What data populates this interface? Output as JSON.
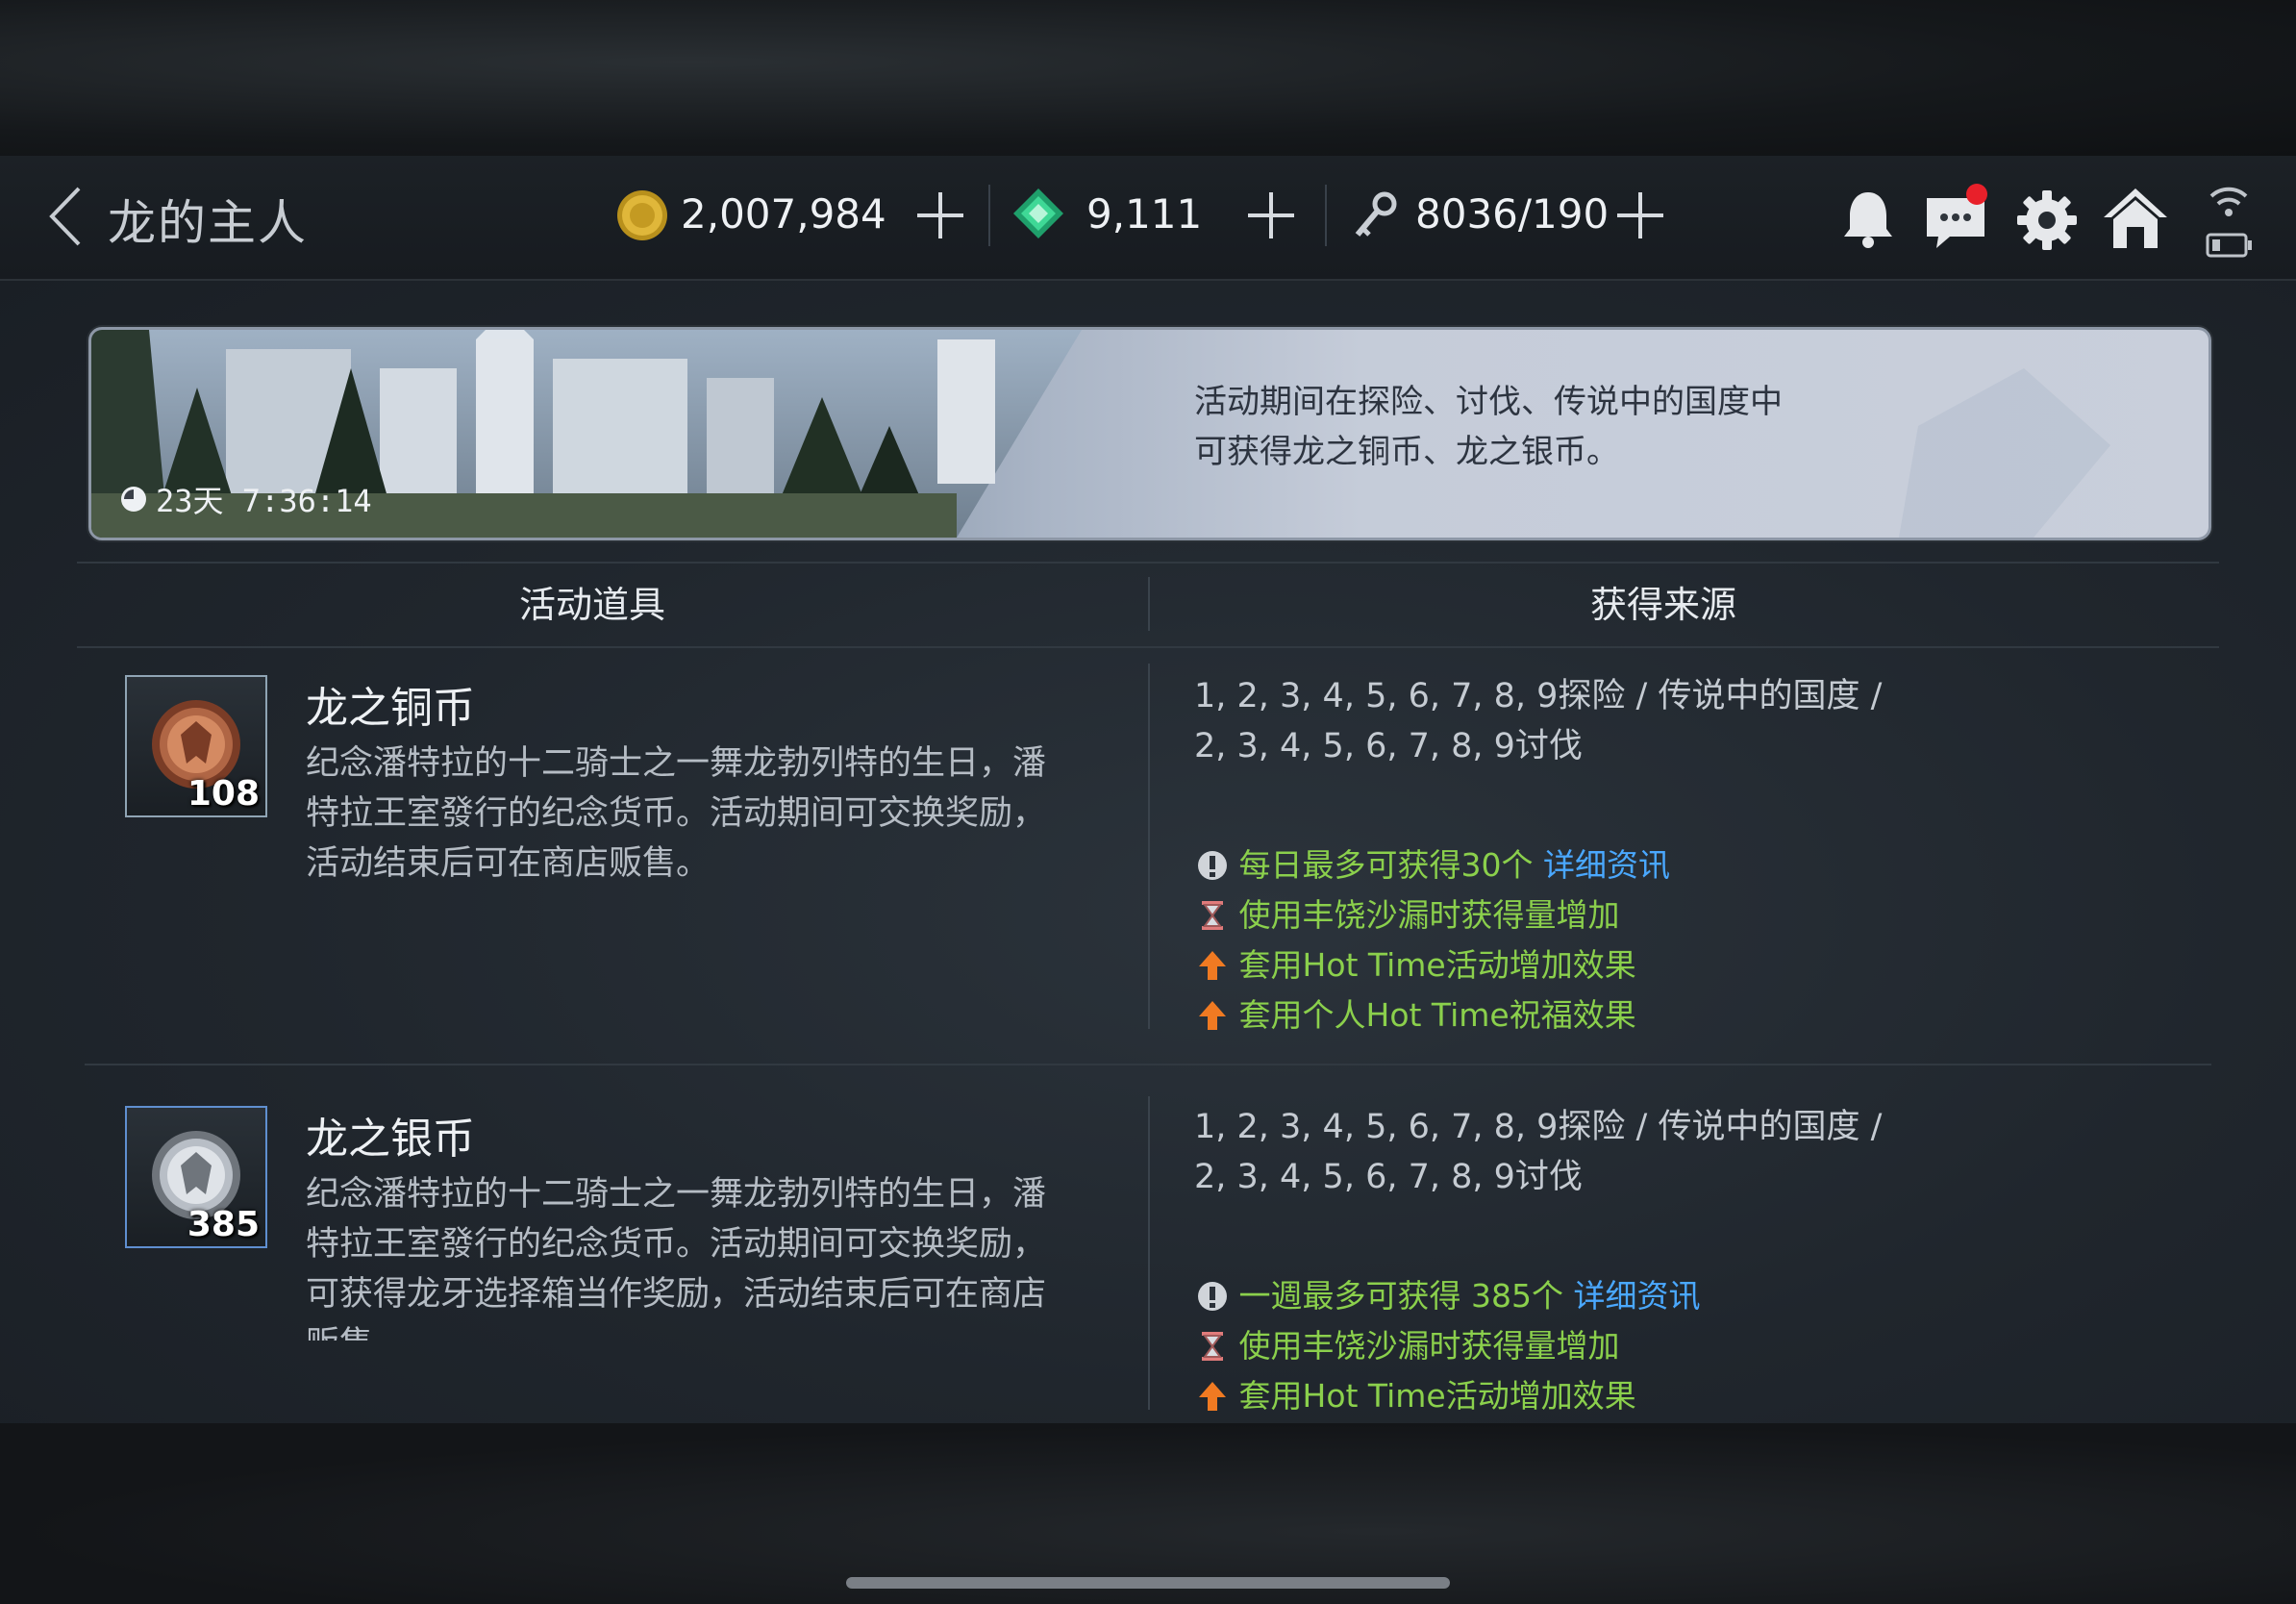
{
  "header": {
    "title": "龙的主人",
    "gold": "2,007,984",
    "gems": "9,111",
    "stamina": "8036/190"
  },
  "banner": {
    "timer": "23天 7:36:14",
    "text_line1": "活动期间在探险、讨伐、传说中的国度中",
    "text_line2": "可获得龙之铜币、龙之银币。"
  },
  "table": {
    "col1": "活动道具",
    "col2": "获得来源"
  },
  "items": [
    {
      "name": "龙之铜币",
      "count": "108",
      "desc_line1": "纪念潘特拉的十二骑士之一舞龙勃列特的生日，潘",
      "desc_line2": "特拉王室發行的纪念货币。活动期间可交换奖励，",
      "desc_line3": "活动结束后可在商店贩售。",
      "desc_line4": "",
      "source_line1": "1, 2, 3, 4, 5, 6, 7, 8, 9探险  /  传说中的国度  /",
      "source_line2": "2, 3, 4, 5, 6, 7, 8, 9讨伐",
      "limit_text": "每日最多可获得30个",
      "limit_link": "详细资讯",
      "note_hourglass": "使用丰饶沙漏时获得量增加",
      "note_hottime": "套用Hot Time活动增加效果",
      "note_personal": "套用个人Hot Time祝福效果"
    },
    {
      "name": "龙之银币",
      "count": "385",
      "desc_line1": "纪念潘特拉的十二骑士之一舞龙勃列特的生日，潘",
      "desc_line2": "特拉王室發行的纪念货币。活动期间可交换奖励，",
      "desc_line3": "可获得龙牙选择箱当作奖励，活动结束后可在商店",
      "desc_line4": "贩售。",
      "source_line1": "1, 2, 3, 4, 5, 6, 7, 8, 9探险  /  传说中的国度  /",
      "source_line2": "2, 3, 4, 5, 6, 7, 8, 9讨伐",
      "limit_text": "一週最多可获得 385个",
      "limit_link": "详细资讯",
      "note_hourglass": "使用丰饶沙漏时获得量增加",
      "note_hottime": "套用Hot Time活动增加效果"
    }
  ],
  "icons": {
    "back": "chevron-left-icon",
    "gold": "gold-coin-icon",
    "gem": "green-gem-icon",
    "stamina": "key-icon",
    "bell": "bell-icon",
    "chat": "chat-icon",
    "settings": "gear-icon",
    "home": "home-icon",
    "wifi": "wifi-icon",
    "battery": "battery-icon"
  },
  "colors": {
    "note_green": "#8bd04c",
    "link_blue": "#4aa8ff",
    "badge_red": "#e8202a"
  }
}
